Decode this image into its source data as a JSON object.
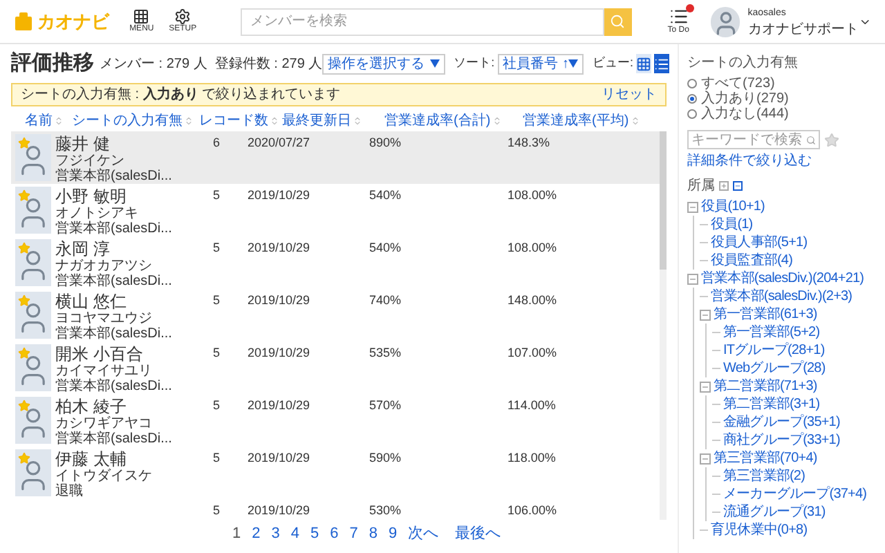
{
  "header": {
    "logo": "カオナビ",
    "menu": "MENU",
    "setup": "SETUP",
    "search": {
      "placeholder": "メンバーを検索"
    },
    "todo": {
      "label": "To Do",
      "unread": true
    },
    "user": {
      "id": "kaosales",
      "org": "カオナビサポート"
    }
  },
  "title": "評価推移",
  "counts": "メンバー : 279 人  登録件数 : 279 人",
  "action_select": "操作を選択する",
  "sort": {
    "label": "ソート:",
    "value": "社員番号 ↑"
  },
  "view": {
    "label": "ビュー:",
    "options": [
      {
        "kind": "grid",
        "selected": false
      },
      {
        "kind": "list",
        "selected": true
      }
    ]
  },
  "filter_notice": {
    "text": "シートの入力有無 : **入力あり** で絞り込まれています",
    "reset": "リセット"
  },
  "table": {
    "columns": [
      "名前",
      "シートの入力有無",
      "レコード数",
      "最終更新日",
      "営業達成率(合計)",
      "営業達成率(平均)"
    ],
    "rows": [
      {
        "name": "藤井 健",
        "kana": "フジイケン",
        "dept": "営業本部(salesDi...",
        "records": "6",
        "updated": "2020/07/27",
        "total": "890%",
        "avg": "148.3%",
        "selected": true
      },
      {
        "name": "小野 敏明",
        "kana": "オノトシアキ",
        "dept": "営業本部(salesDi...",
        "records": "5",
        "updated": "2019/10/29",
        "total": "540%",
        "avg": "108.00%",
        "selected": false
      },
      {
        "name": "永岡 淳",
        "kana": "ナガオカアツシ",
        "dept": "営業本部(salesDi...",
        "records": "5",
        "updated": "2019/10/29",
        "total": "540%",
        "avg": "108.00%",
        "selected": false
      },
      {
        "name": "横山 悠仁",
        "kana": "ヨコヤマユウジ",
        "dept": "営業本部(salesDi...",
        "records": "5",
        "updated": "2019/10/29",
        "total": "740%",
        "avg": "148.00%",
        "selected": false
      },
      {
        "name": "開米 小百合",
        "kana": "カイマイサユリ",
        "dept": "営業本部(salesDi...",
        "records": "5",
        "updated": "2019/10/29",
        "total": "535%",
        "avg": "107.00%",
        "selected": false
      },
      {
        "name": "柏木 綾子",
        "kana": "カシワギアヤコ",
        "dept": "営業本部(salesDi...",
        "records": "5",
        "updated": "2019/10/29",
        "total": "570%",
        "avg": "114.00%",
        "selected": false
      },
      {
        "name": "伊藤 太輔",
        "kana": "イトウダイスケ",
        "dept": "退職",
        "records": "5",
        "updated": "2019/10/29",
        "total": "590%",
        "avg": "118.00%",
        "selected": false
      },
      {
        "records": "5",
        "updated": "2019/10/29",
        "total": "530%",
        "avg": "106.00%",
        "selected": false
      }
    ]
  },
  "pagination": {
    "pages": [
      {
        "label": "1",
        "selected": true
      },
      {
        "label": "2",
        "selected": false
      },
      {
        "label": "3",
        "selected": false
      },
      {
        "label": "4",
        "selected": false
      },
      {
        "label": "5",
        "selected": false
      },
      {
        "label": "6",
        "selected": false
      },
      {
        "label": "7",
        "selected": false
      },
      {
        "label": "8",
        "selected": false
      },
      {
        "label": "9",
        "selected": false
      }
    ],
    "next": "次へ",
    "last": "最後へ"
  },
  "sidebar": {
    "filter_title": "シートの入力有無",
    "options": [
      {
        "label": "すべて(723)",
        "selected": false
      },
      {
        "label": "入力あり(279)",
        "selected": true
      },
      {
        "label": "入力なし(444)",
        "selected": false
      }
    ],
    "search": {
      "placeholder": "キーワードで検索"
    },
    "advanced": "詳細条件で絞り込む",
    "tree_title": "所属",
    "tree": [
      {
        "label": "役員(10+1)",
        "expanded": true,
        "children": [
          {
            "label": "役員(1)"
          },
          {
            "label": "役員人事部(5+1)"
          },
          {
            "label": "役員監査部(4)"
          }
        ]
      },
      {
        "label": "営業本部(salesDiv.)(204+21)",
        "expanded": true,
        "children": [
          {
            "label": "営業本部(salesDiv.)(2+3)"
          },
          {
            "label": "第一営業部(61+3)",
            "expanded": true,
            "children": [
              {
                "label": "第一営業部(5+2)"
              },
              {
                "label": "ITグループ(28+1)"
              },
              {
                "label": "Webグループ(28)"
              }
            ]
          },
          {
            "label": "第二営業部(71+3)",
            "expanded": true,
            "children": [
              {
                "label": "第二営業部(3+1)"
              },
              {
                "label": "金融グループ(35+1)"
              },
              {
                "label": "商社グループ(33+1)"
              }
            ]
          },
          {
            "label": "第三営業部(70+4)",
            "expanded": true,
            "children": [
              {
                "label": "第三営業部(2)"
              },
              {
                "label": "メーカーグループ(37+4)"
              },
              {
                "label": "流通グループ(31)"
              }
            ]
          },
          {
            "label": "育児休業中(0+8)"
          }
        ]
      }
    ]
  }
}
